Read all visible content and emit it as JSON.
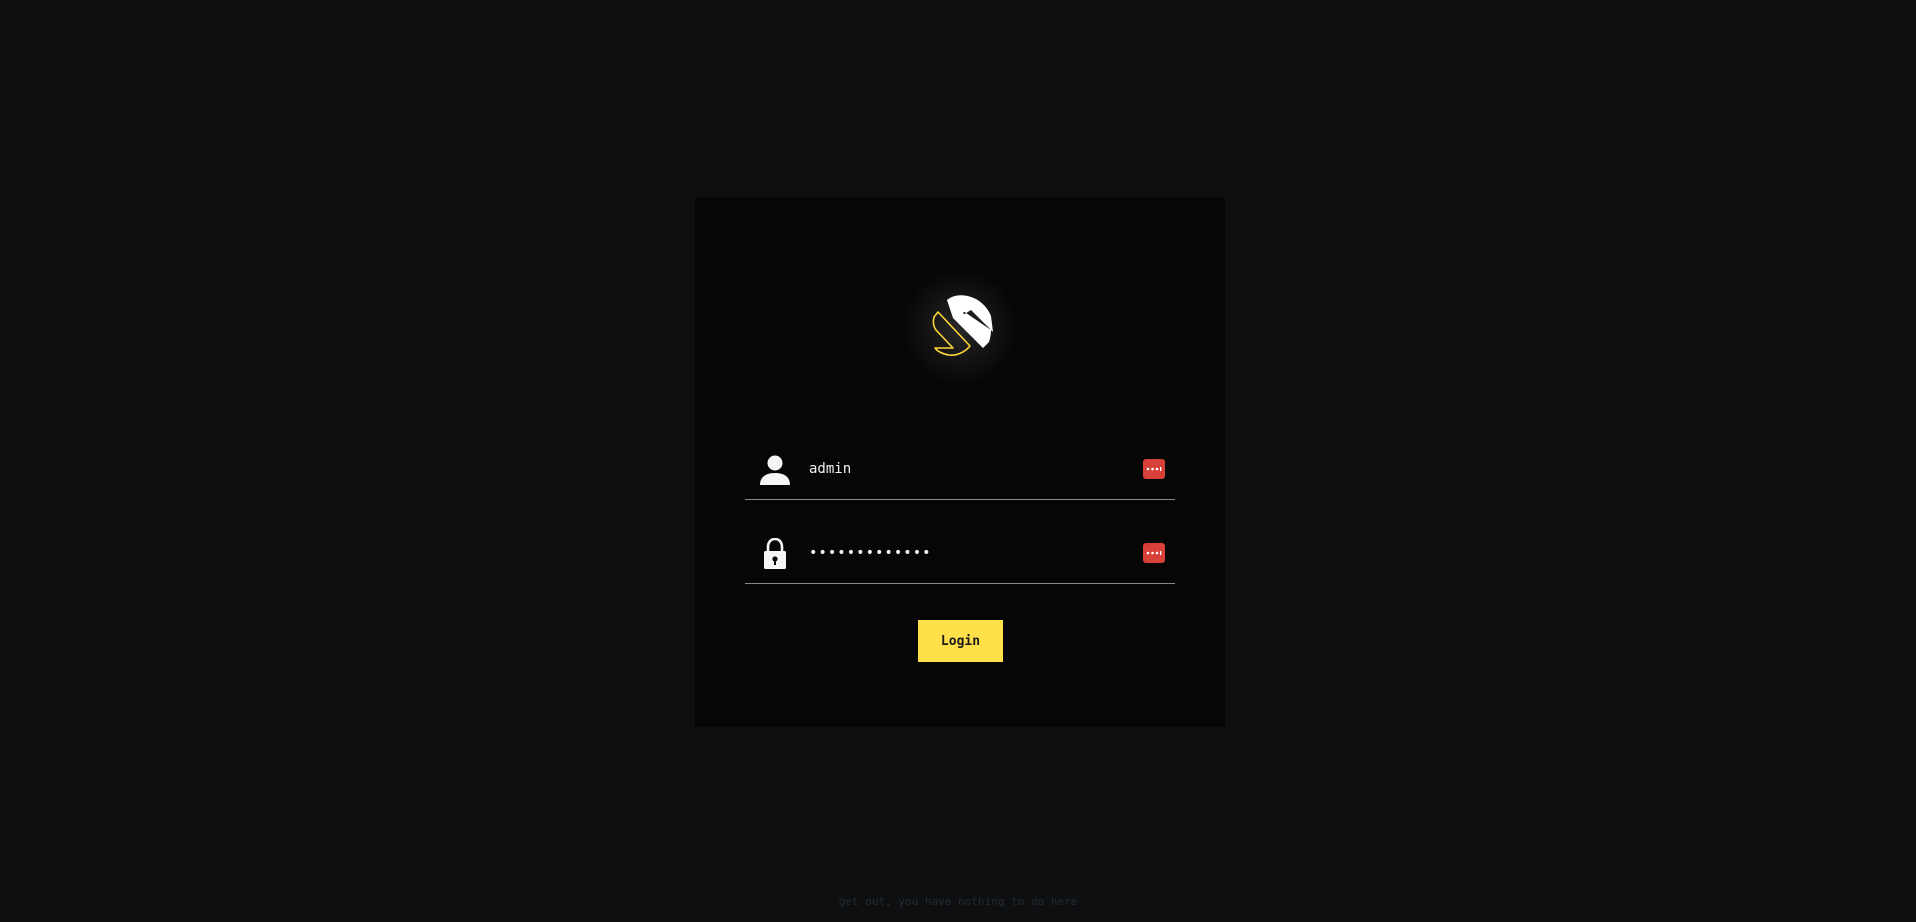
{
  "login_form": {
    "logo_icon": "app-logo",
    "username": {
      "icon": "user-icon",
      "value": "admin"
    },
    "password": {
      "icon": "lock-icon",
      "value": "•••••••••••••"
    },
    "password_manager_icon": "password-manager-icon",
    "login_label": "Login"
  },
  "footer": {
    "text": "get out, you have nothing to do here"
  },
  "colors": {
    "background": "#0d0f11",
    "card": "#060606",
    "accent": "#ffe04a",
    "password_manager": "#d8413a"
  }
}
